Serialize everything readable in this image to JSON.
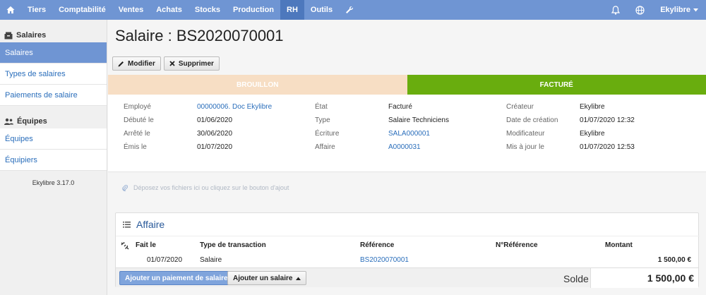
{
  "topnav": {
    "home_icon": "home-icon",
    "items": [
      {
        "label": "Tiers"
      },
      {
        "label": "Comptabilité"
      },
      {
        "label": "Ventes"
      },
      {
        "label": "Achats"
      },
      {
        "label": "Stocks"
      },
      {
        "label": "Production"
      },
      {
        "label": "RH"
      },
      {
        "label": "Outils"
      }
    ],
    "active": "RH",
    "wrench_icon": "wrench-icon",
    "bell_icon": "bell-icon",
    "globe_icon": "globe-icon",
    "user_label": "Ekylibre"
  },
  "sidebar": {
    "section1": {
      "label": "Salaires",
      "icon": "cash-register-icon"
    },
    "section1_items": [
      {
        "label": "Salaires"
      },
      {
        "label": "Types de salaires"
      },
      {
        "label": "Paiements de salaire"
      }
    ],
    "section2": {
      "label": "Équipes",
      "icon": "team-icon"
    },
    "section2_items": [
      {
        "label": "Équipes"
      },
      {
        "label": "Équipiers"
      }
    ],
    "version": "Ekylibre 3.17.0"
  },
  "page": {
    "title": "Salaire : BS2020070001",
    "edit_label": "Modifier",
    "delete_label": "Supprimer"
  },
  "status": {
    "draft": "BROUILLON",
    "invoiced": "FACTURÉ",
    "draft_color": "#f7dec4",
    "invoiced_color": "#69ad0e"
  },
  "details": {
    "employee_label": "Employé",
    "employee_value": "00000006. Doc Ekylibre",
    "started_label": "Débuté le",
    "started_value": "01/06/2020",
    "stopped_label": "Arrêté le",
    "stopped_value": "30/06/2020",
    "emitted_label": "Émis le",
    "emitted_value": "01/07/2020",
    "state_label": "État",
    "state_value": "Facturé",
    "type_label": "Type",
    "type_value": "Salaire Techniciens",
    "entry_label": "Écriture",
    "entry_value": "SALA000001",
    "affair_label": "Affaire",
    "affair_value": "A0000031",
    "creator_label": "Créateur",
    "creator_value": "Ekylibre",
    "created_label": "Date de création",
    "created_value": "01/07/2020 12:32",
    "updater_label": "Modificateur",
    "updater_value": "Ekylibre",
    "updated_label": "Mis à jour le",
    "updated_value": "01/07/2020 12:53"
  },
  "dropzone": {
    "text": "Déposez vos fichiers ici ou cliquez sur le bouton d'ajout"
  },
  "affair_panel": {
    "title": "Affaire",
    "columns": {
      "date": "Fait le",
      "transaction_type": "Type de transaction",
      "reference": "Référence",
      "reference_number": "N°Référence",
      "amount": "Montant"
    },
    "rows": [
      {
        "date": "01/07/2020",
        "transaction_type": "Salaire",
        "reference": "BS2020070001",
        "reference_number": "",
        "amount": "1 500,00 €"
      }
    ],
    "add_payment_label": "Ajouter un paiement de salaire",
    "add_salary_label": "Ajouter un salaire",
    "balance_label": "Solde",
    "balance_value": "1 500,00 €"
  }
}
